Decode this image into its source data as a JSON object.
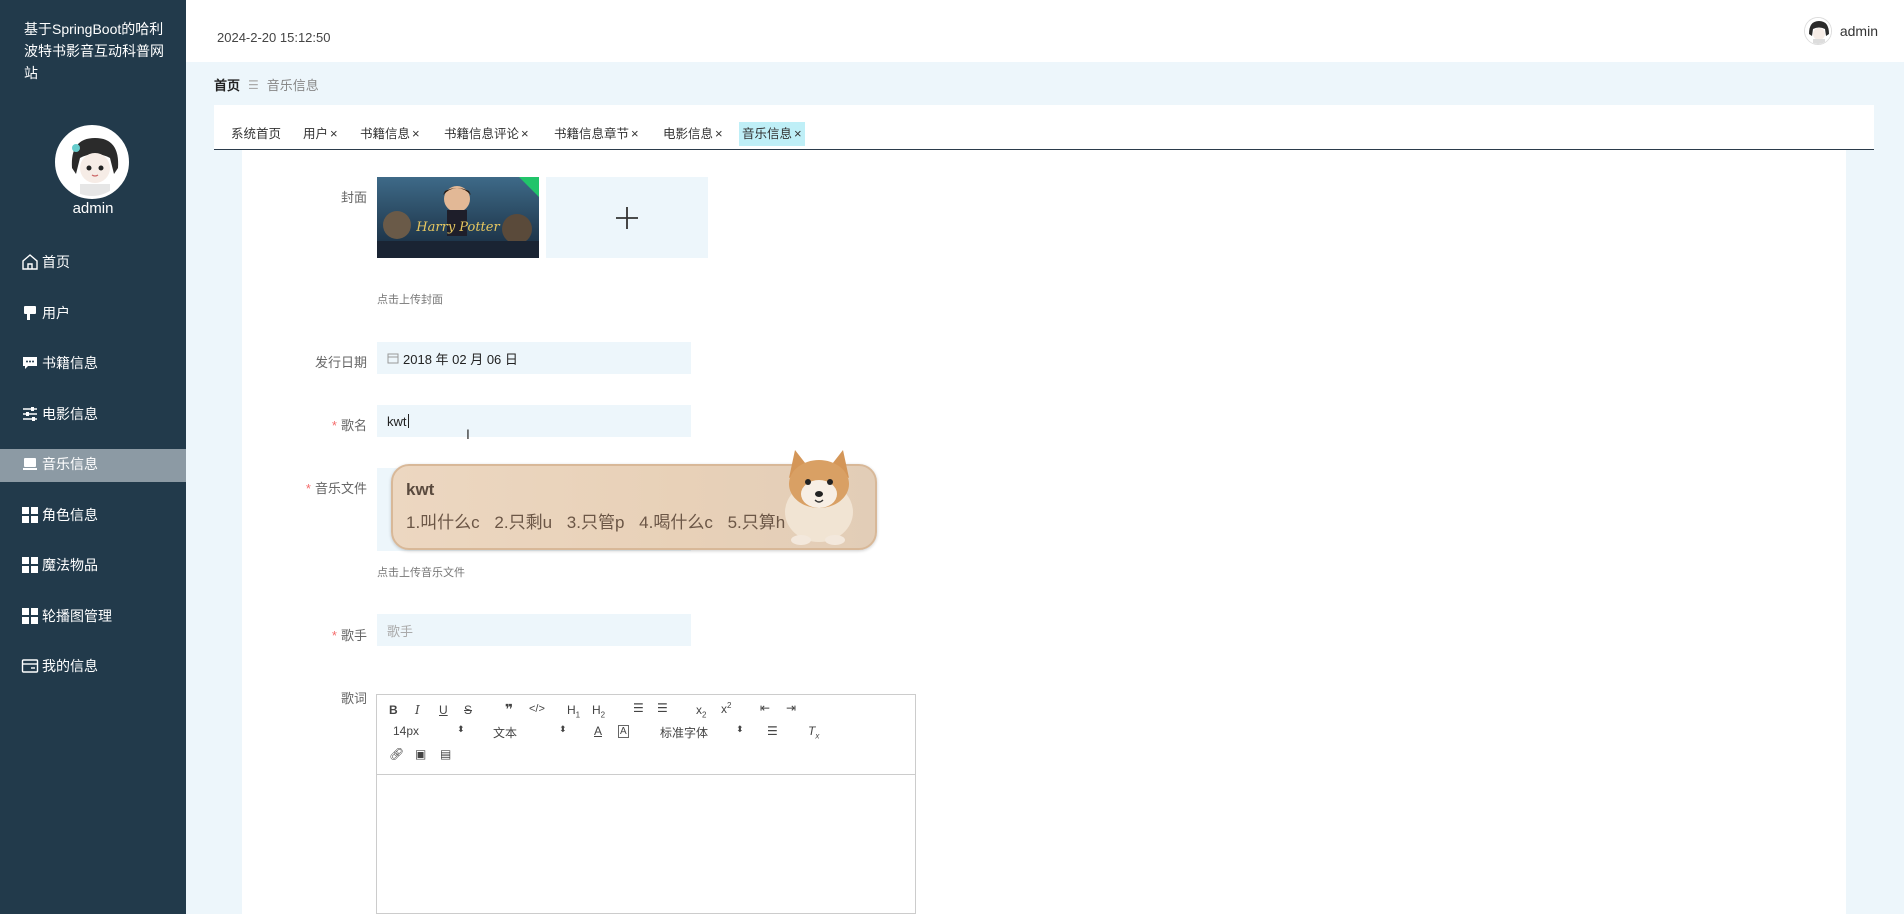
{
  "app": {
    "title": "基于SpringBoot的哈利波特书影音互动科普网站",
    "datetime": "2024-2-20 15:12:50"
  },
  "user": {
    "name": "admin"
  },
  "sidebar": {
    "items": [
      {
        "label": "首页",
        "icon": "home-icon"
      },
      {
        "label": "用户",
        "icon": "user-icon"
      },
      {
        "label": "书籍信息",
        "icon": "chat-icon"
      },
      {
        "label": "电影信息",
        "icon": "sliders-icon"
      },
      {
        "label": "音乐信息",
        "icon": "monitor-icon",
        "active": true
      },
      {
        "label": "角色信息",
        "icon": "grid-icon"
      },
      {
        "label": "魔法物品",
        "icon": "grid-icon"
      },
      {
        "label": "轮播图管理",
        "icon": "grid-icon"
      },
      {
        "label": "我的信息",
        "icon": "card-icon"
      }
    ]
  },
  "breadcrumb": {
    "home": "首页",
    "current": "音乐信息"
  },
  "tabs": [
    {
      "label": "系统首页",
      "closable": false
    },
    {
      "label": "用户",
      "closable": true
    },
    {
      "label": "书籍信息",
      "closable": true
    },
    {
      "label": "书籍信息评论",
      "closable": true
    },
    {
      "label": "书籍信息章节",
      "closable": true
    },
    {
      "label": "电影信息",
      "closable": true
    },
    {
      "label": "音乐信息",
      "closable": true,
      "active": true
    }
  ],
  "form": {
    "cover": {
      "label": "封面",
      "hint": "点击上传封面",
      "upload_glyph": "+"
    },
    "release_date": {
      "label": "发行日期",
      "value": "2018 年 02 月 06 日"
    },
    "song_name": {
      "label": "歌名",
      "value": "kwt",
      "required": true
    },
    "music_file": {
      "label": "音乐文件",
      "hint": "点击上传音乐文件",
      "required": true
    },
    "singer": {
      "label": "歌手",
      "placeholder": "歌手",
      "required": true
    },
    "lyrics": {
      "label": "歌词"
    }
  },
  "ime": {
    "typed": "kwt",
    "candidates": [
      "1.叫什么c",
      "2.只剩u",
      "3.只管p",
      "4.喝什么c",
      "5.只算h"
    ]
  },
  "editor_toolbar": {
    "font_size": "14px",
    "heading": "文本",
    "font_family": "标准字体"
  },
  "colors": {
    "sidebar": "#223a4b",
    "active_tab": "#bfeff7",
    "required": "#f56c6c"
  }
}
